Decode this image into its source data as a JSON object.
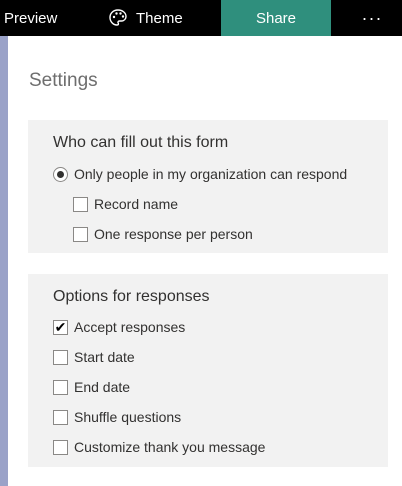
{
  "toolbar": {
    "preview_label": "Preview",
    "theme_label": "Theme",
    "share_label": "Share",
    "more_label": "···",
    "share_color": "#2f8f7d"
  },
  "settings": {
    "title": "Settings",
    "who": {
      "heading": "Who can fill out this form",
      "radio_label": "Only people in my organization can respond",
      "radio_checked": true,
      "options": [
        {
          "label": "Record name",
          "checked": false
        },
        {
          "label": "One response per person",
          "checked": false
        }
      ]
    },
    "responses": {
      "heading": "Options for responses",
      "options": [
        {
          "label": "Accept responses",
          "checked": true
        },
        {
          "label": "Start date",
          "checked": false
        },
        {
          "label": "End date",
          "checked": false
        },
        {
          "label": "Shuffle questions",
          "checked": false
        },
        {
          "label": "Customize thank you message",
          "checked": false
        }
      ]
    }
  }
}
